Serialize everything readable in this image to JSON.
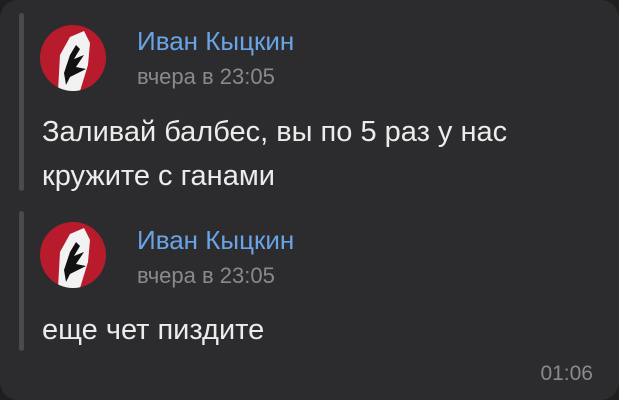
{
  "forwarded": [
    {
      "author": "Иван Кыцкин",
      "time": "вчера в 23:05",
      "lines": [
        "Заливай балбес, вы по 5 раз у нас",
        "кружите с ганами"
      ]
    },
    {
      "author": "Иван Кыцкин",
      "time": "вчера в 23:05",
      "lines": [
        "еще чет пиздите"
      ]
    }
  ],
  "message_time": "01:06",
  "colors": {
    "background": "#1f1f1f",
    "bubble": "#2c2c2e",
    "author": "#6aa3e6",
    "meta": "#8a8a8e",
    "text": "#ececec",
    "avatar_red": "#b81c2c"
  },
  "icons": {
    "avatar": "avatar-image"
  }
}
